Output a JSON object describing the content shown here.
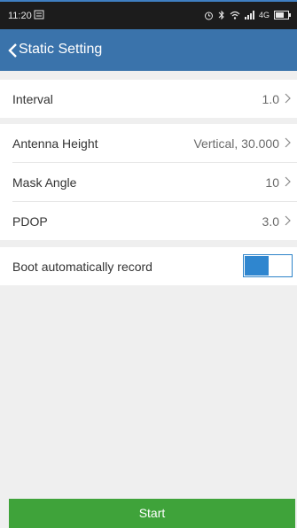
{
  "status_bar": {
    "time": "11:20",
    "network": "4G"
  },
  "header": {
    "title": "Static Setting"
  },
  "settings": {
    "interval": {
      "label": "Interval",
      "value": "1.0"
    },
    "antenna_height": {
      "label": "Antenna Height",
      "value": "Vertical, 30.000"
    },
    "mask_angle": {
      "label": "Mask Angle",
      "value": "10"
    },
    "pdop": {
      "label": "PDOP",
      "value": "3.0"
    },
    "boot_record": {
      "label": "Boot automatically record",
      "enabled": true
    }
  },
  "actions": {
    "start_label": "Start"
  },
  "colors": {
    "header": "#3a73ab",
    "accent": "#2f86cf",
    "start_button": "#3fa33a"
  }
}
